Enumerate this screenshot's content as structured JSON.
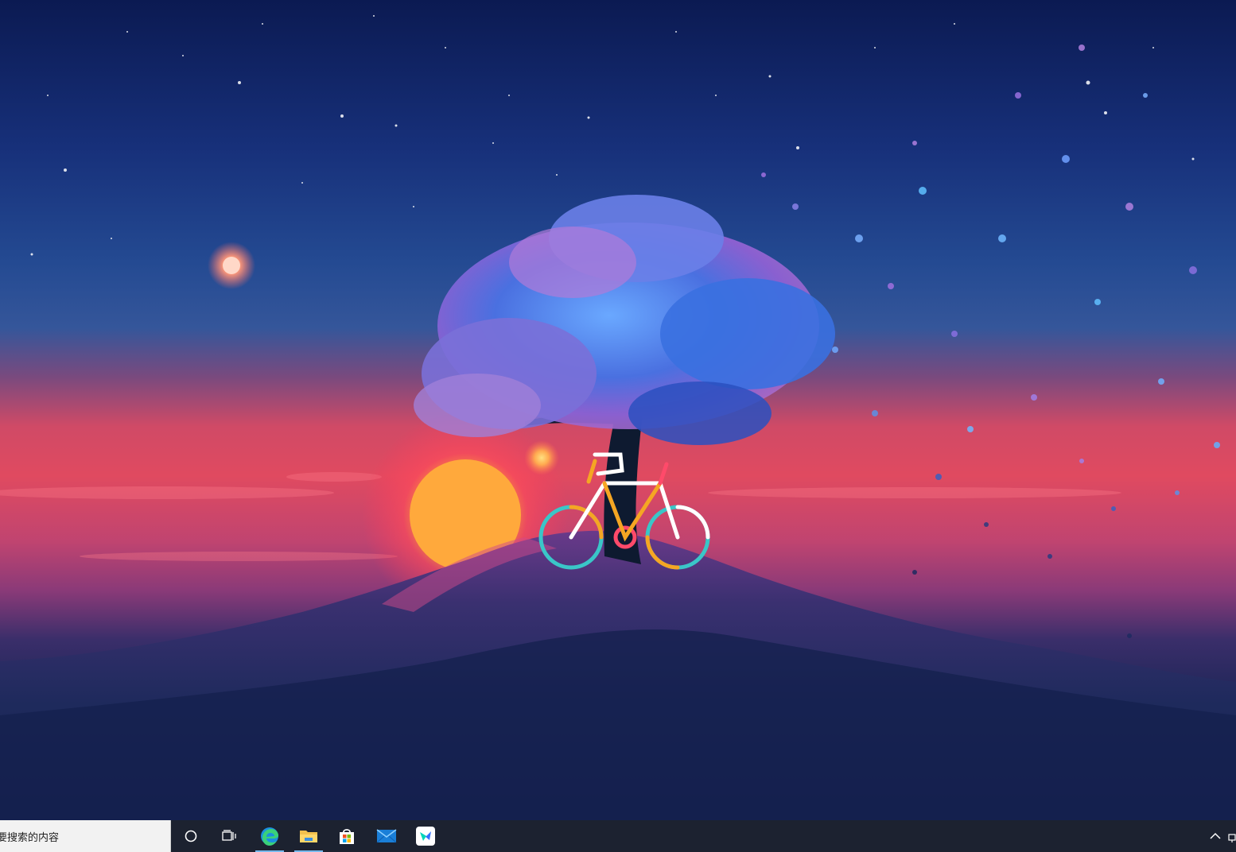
{
  "taskbar": {
    "search": {
      "placeholder": "要搜索的内容"
    },
    "buttons": [
      {
        "name": "cortana-button",
        "icon": "cortana-circle-icon"
      },
      {
        "name": "task-view-button",
        "icon": "task-view-icon"
      },
      {
        "name": "edge-button",
        "icon": "edge-icon",
        "active": true
      },
      {
        "name": "file-explorer-button",
        "icon": "folder-icon",
        "active": true
      },
      {
        "name": "store-button",
        "icon": "store-icon"
      },
      {
        "name": "mail-button",
        "icon": "mail-icon"
      },
      {
        "name": "feishu-button",
        "icon": "feishu-icon"
      }
    ],
    "tray": {
      "overflow_icon": "chevron-up-icon"
    }
  },
  "colors": {
    "taskbar_bg": "#1c2230",
    "search_bg": "#f2f2f2",
    "active_indicator": "#76b9ed"
  }
}
